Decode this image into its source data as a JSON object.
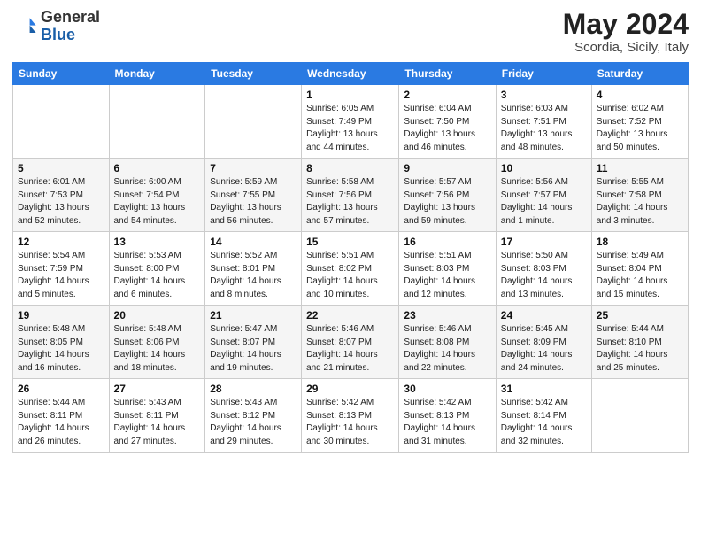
{
  "header": {
    "logo_general": "General",
    "logo_blue": "Blue",
    "month_year": "May 2024",
    "location": "Scordia, Sicily, Italy"
  },
  "weekdays": [
    "Sunday",
    "Monday",
    "Tuesday",
    "Wednesday",
    "Thursday",
    "Friday",
    "Saturday"
  ],
  "weeks": [
    [
      {
        "day": "",
        "sunrise": "",
        "sunset": "",
        "daylight": ""
      },
      {
        "day": "",
        "sunrise": "",
        "sunset": "",
        "daylight": ""
      },
      {
        "day": "",
        "sunrise": "",
        "sunset": "",
        "daylight": ""
      },
      {
        "day": "1",
        "sunrise": "Sunrise: 6:05 AM",
        "sunset": "Sunset: 7:49 PM",
        "daylight": "Daylight: 13 hours and 44 minutes."
      },
      {
        "day": "2",
        "sunrise": "Sunrise: 6:04 AM",
        "sunset": "Sunset: 7:50 PM",
        "daylight": "Daylight: 13 hours and 46 minutes."
      },
      {
        "day": "3",
        "sunrise": "Sunrise: 6:03 AM",
        "sunset": "Sunset: 7:51 PM",
        "daylight": "Daylight: 13 hours and 48 minutes."
      },
      {
        "day": "4",
        "sunrise": "Sunrise: 6:02 AM",
        "sunset": "Sunset: 7:52 PM",
        "daylight": "Daylight: 13 hours and 50 minutes."
      }
    ],
    [
      {
        "day": "5",
        "sunrise": "Sunrise: 6:01 AM",
        "sunset": "Sunset: 7:53 PM",
        "daylight": "Daylight: 13 hours and 52 minutes."
      },
      {
        "day": "6",
        "sunrise": "Sunrise: 6:00 AM",
        "sunset": "Sunset: 7:54 PM",
        "daylight": "Daylight: 13 hours and 54 minutes."
      },
      {
        "day": "7",
        "sunrise": "Sunrise: 5:59 AM",
        "sunset": "Sunset: 7:55 PM",
        "daylight": "Daylight: 13 hours and 56 minutes."
      },
      {
        "day": "8",
        "sunrise": "Sunrise: 5:58 AM",
        "sunset": "Sunset: 7:56 PM",
        "daylight": "Daylight: 13 hours and 57 minutes."
      },
      {
        "day": "9",
        "sunrise": "Sunrise: 5:57 AM",
        "sunset": "Sunset: 7:56 PM",
        "daylight": "Daylight: 13 hours and 59 minutes."
      },
      {
        "day": "10",
        "sunrise": "Sunrise: 5:56 AM",
        "sunset": "Sunset: 7:57 PM",
        "daylight": "Daylight: 14 hours and 1 minute."
      },
      {
        "day": "11",
        "sunrise": "Sunrise: 5:55 AM",
        "sunset": "Sunset: 7:58 PM",
        "daylight": "Daylight: 14 hours and 3 minutes."
      }
    ],
    [
      {
        "day": "12",
        "sunrise": "Sunrise: 5:54 AM",
        "sunset": "Sunset: 7:59 PM",
        "daylight": "Daylight: 14 hours and 5 minutes."
      },
      {
        "day": "13",
        "sunrise": "Sunrise: 5:53 AM",
        "sunset": "Sunset: 8:00 PM",
        "daylight": "Daylight: 14 hours and 6 minutes."
      },
      {
        "day": "14",
        "sunrise": "Sunrise: 5:52 AM",
        "sunset": "Sunset: 8:01 PM",
        "daylight": "Daylight: 14 hours and 8 minutes."
      },
      {
        "day": "15",
        "sunrise": "Sunrise: 5:51 AM",
        "sunset": "Sunset: 8:02 PM",
        "daylight": "Daylight: 14 hours and 10 minutes."
      },
      {
        "day": "16",
        "sunrise": "Sunrise: 5:51 AM",
        "sunset": "Sunset: 8:03 PM",
        "daylight": "Daylight: 14 hours and 12 minutes."
      },
      {
        "day": "17",
        "sunrise": "Sunrise: 5:50 AM",
        "sunset": "Sunset: 8:03 PM",
        "daylight": "Daylight: 14 hours and 13 minutes."
      },
      {
        "day": "18",
        "sunrise": "Sunrise: 5:49 AM",
        "sunset": "Sunset: 8:04 PM",
        "daylight": "Daylight: 14 hours and 15 minutes."
      }
    ],
    [
      {
        "day": "19",
        "sunrise": "Sunrise: 5:48 AM",
        "sunset": "Sunset: 8:05 PM",
        "daylight": "Daylight: 14 hours and 16 minutes."
      },
      {
        "day": "20",
        "sunrise": "Sunrise: 5:48 AM",
        "sunset": "Sunset: 8:06 PM",
        "daylight": "Daylight: 14 hours and 18 minutes."
      },
      {
        "day": "21",
        "sunrise": "Sunrise: 5:47 AM",
        "sunset": "Sunset: 8:07 PM",
        "daylight": "Daylight: 14 hours and 19 minutes."
      },
      {
        "day": "22",
        "sunrise": "Sunrise: 5:46 AM",
        "sunset": "Sunset: 8:07 PM",
        "daylight": "Daylight: 14 hours and 21 minutes."
      },
      {
        "day": "23",
        "sunrise": "Sunrise: 5:46 AM",
        "sunset": "Sunset: 8:08 PM",
        "daylight": "Daylight: 14 hours and 22 minutes."
      },
      {
        "day": "24",
        "sunrise": "Sunrise: 5:45 AM",
        "sunset": "Sunset: 8:09 PM",
        "daylight": "Daylight: 14 hours and 24 minutes."
      },
      {
        "day": "25",
        "sunrise": "Sunrise: 5:44 AM",
        "sunset": "Sunset: 8:10 PM",
        "daylight": "Daylight: 14 hours and 25 minutes."
      }
    ],
    [
      {
        "day": "26",
        "sunrise": "Sunrise: 5:44 AM",
        "sunset": "Sunset: 8:11 PM",
        "daylight": "Daylight: 14 hours and 26 minutes."
      },
      {
        "day": "27",
        "sunrise": "Sunrise: 5:43 AM",
        "sunset": "Sunset: 8:11 PM",
        "daylight": "Daylight: 14 hours and 27 minutes."
      },
      {
        "day": "28",
        "sunrise": "Sunrise: 5:43 AM",
        "sunset": "Sunset: 8:12 PM",
        "daylight": "Daylight: 14 hours and 29 minutes."
      },
      {
        "day": "29",
        "sunrise": "Sunrise: 5:42 AM",
        "sunset": "Sunset: 8:13 PM",
        "daylight": "Daylight: 14 hours and 30 minutes."
      },
      {
        "day": "30",
        "sunrise": "Sunrise: 5:42 AM",
        "sunset": "Sunset: 8:13 PM",
        "daylight": "Daylight: 14 hours and 31 minutes."
      },
      {
        "day": "31",
        "sunrise": "Sunrise: 5:42 AM",
        "sunset": "Sunset: 8:14 PM",
        "daylight": "Daylight: 14 hours and 32 minutes."
      },
      {
        "day": "",
        "sunrise": "",
        "sunset": "",
        "daylight": ""
      }
    ]
  ]
}
